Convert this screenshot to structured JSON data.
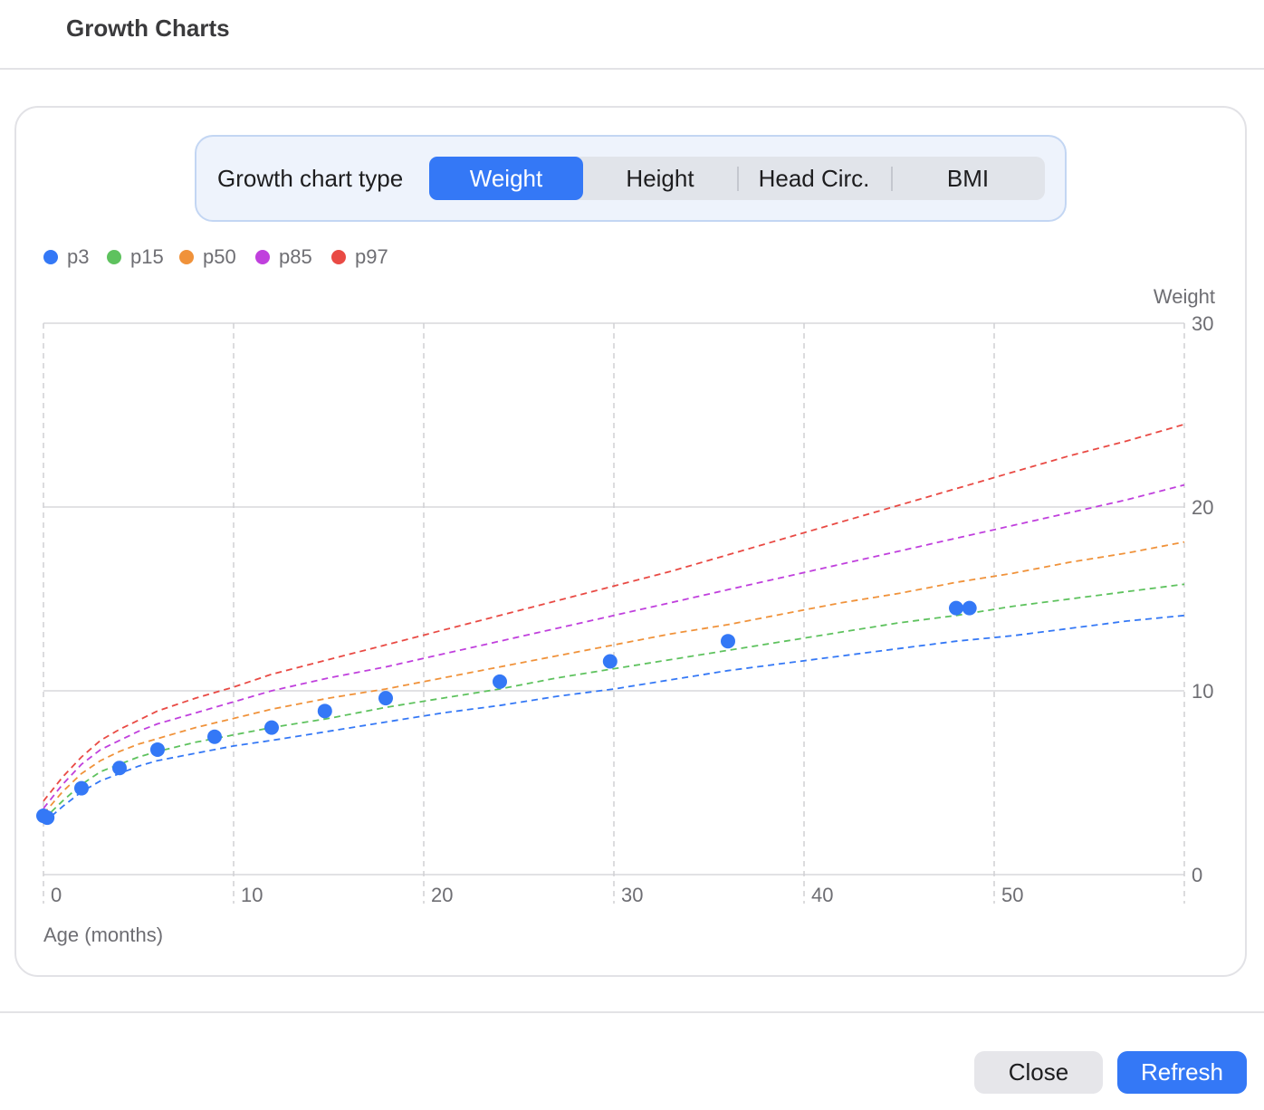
{
  "window": {
    "title": "Growth Charts"
  },
  "chart_type_selector": {
    "label": "Growth chart type",
    "options": [
      "Weight",
      "Height",
      "Head Circ.",
      "BMI"
    ],
    "selected": "Weight"
  },
  "legend": [
    {
      "label": "p3",
      "color": "#3478f6"
    },
    {
      "label": "p15",
      "color": "#5ec25e"
    },
    {
      "label": "p50",
      "color": "#f0923a"
    },
    {
      "label": "p85",
      "color": "#c040dd"
    },
    {
      "label": "p97",
      "color": "#e94a44"
    }
  ],
  "chart_data": {
    "type": "line",
    "title": "",
    "xlabel": "Age (months)",
    "ylabel": "Weight",
    "xlim": [
      0,
      60
    ],
    "ylim": [
      0,
      30
    ],
    "x_ticks": [
      0,
      10,
      20,
      30,
      40,
      50
    ],
    "y_ticks": [
      0,
      10,
      20,
      30
    ],
    "y_axis_position": "right",
    "grid": true,
    "legend_position": "top-left",
    "x": [
      0,
      1,
      2,
      3,
      4,
      5,
      6,
      8,
      10,
      12,
      15,
      18,
      21,
      24,
      27,
      30,
      33,
      36,
      39,
      42,
      45,
      48,
      51,
      54,
      57,
      60
    ],
    "series": [
      {
        "name": "p3",
        "color": "#3478f6",
        "values": [
          2.8,
          3.7,
          4.5,
          5.1,
          5.5,
          5.9,
          6.2,
          6.6,
          7.0,
          7.3,
          7.8,
          8.3,
          8.8,
          9.2,
          9.7,
          10.1,
          10.6,
          11.1,
          11.5,
          11.9,
          12.3,
          12.7,
          13.0,
          13.4,
          13.8,
          14.1
        ]
      },
      {
        "name": "p15",
        "color": "#5ec25e",
        "values": [
          3.0,
          4.0,
          4.9,
          5.6,
          6.0,
          6.4,
          6.7,
          7.2,
          7.6,
          8.0,
          8.5,
          9.1,
          9.6,
          10.1,
          10.7,
          11.2,
          11.7,
          12.2,
          12.7,
          13.2,
          13.7,
          14.1,
          14.6,
          15.0,
          15.4,
          15.8
        ]
      },
      {
        "name": "p50",
        "color": "#f0923a",
        "values": [
          3.3,
          4.5,
          5.5,
          6.2,
          6.7,
          7.1,
          7.4,
          8.0,
          8.5,
          9.0,
          9.6,
          10.1,
          10.7,
          11.3,
          11.9,
          12.5,
          13.1,
          13.6,
          14.2,
          14.8,
          15.3,
          15.9,
          16.4,
          17.0,
          17.5,
          18.1
        ]
      },
      {
        "name": "p85",
        "color": "#c040dd",
        "values": [
          3.6,
          4.9,
          6.0,
          6.8,
          7.3,
          7.8,
          8.2,
          8.8,
          9.4,
          10.0,
          10.7,
          11.3,
          12.0,
          12.7,
          13.4,
          14.1,
          14.8,
          15.5,
          16.2,
          16.9,
          17.6,
          18.3,
          19.0,
          19.7,
          20.4,
          21.2
        ]
      },
      {
        "name": "p97",
        "color": "#e94a44",
        "values": [
          4.0,
          5.3,
          6.4,
          7.3,
          7.9,
          8.4,
          8.9,
          9.6,
          10.2,
          10.9,
          11.7,
          12.5,
          13.3,
          14.1,
          14.9,
          15.7,
          16.5,
          17.4,
          18.3,
          19.2,
          20.1,
          21.0,
          21.9,
          22.8,
          23.6,
          24.5
        ]
      }
    ],
    "measurements": {
      "color": "#3478f6",
      "points": [
        {
          "x": 0,
          "y": 3.2
        },
        {
          "x": 0.2,
          "y": 3.1
        },
        {
          "x": 2,
          "y": 4.7
        },
        {
          "x": 4,
          "y": 5.8
        },
        {
          "x": 6,
          "y": 6.8
        },
        {
          "x": 9,
          "y": 7.5
        },
        {
          "x": 12,
          "y": 8.0
        },
        {
          "x": 14.8,
          "y": 8.9
        },
        {
          "x": 18,
          "y": 9.6
        },
        {
          "x": 24,
          "y": 10.5
        },
        {
          "x": 29.8,
          "y": 11.6
        },
        {
          "x": 36,
          "y": 12.7
        },
        {
          "x": 48,
          "y": 14.5
        },
        {
          "x": 48.7,
          "y": 14.5
        }
      ]
    }
  },
  "footer": {
    "close_label": "Close",
    "refresh_label": "Refresh"
  }
}
